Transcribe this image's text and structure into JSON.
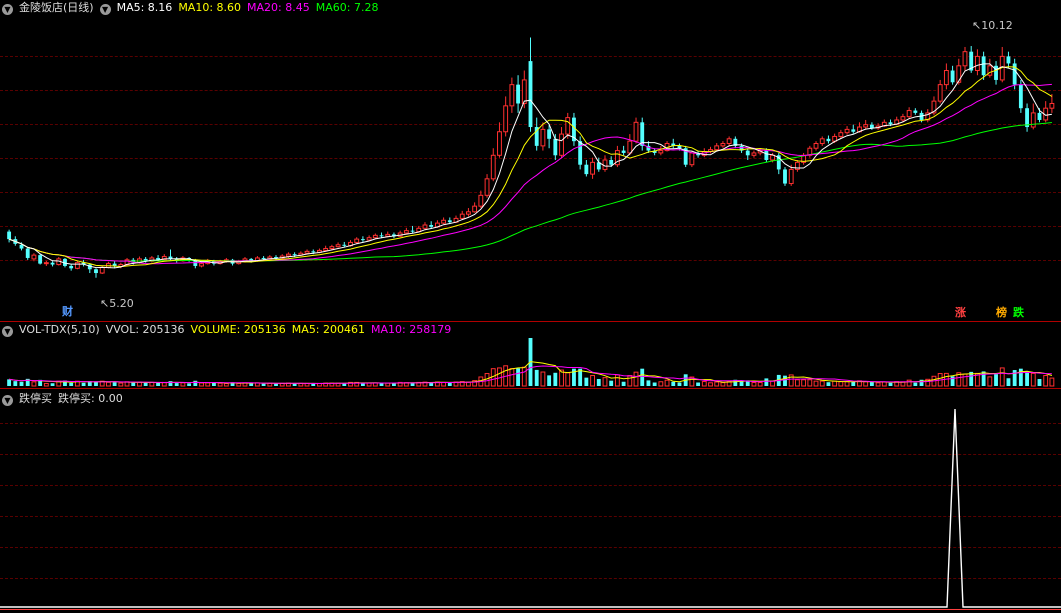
{
  "main_panel": {
    "title": "金陵饭店(日线)",
    "ma_legend": [
      {
        "label": "MA5: 8.16",
        "color": "#ffffff"
      },
      {
        "label": "MA10: 8.60",
        "color": "#ffff00"
      },
      {
        "label": "MA20: 8.45",
        "color": "#ff00ff"
      },
      {
        "label": "MA60: 7.28",
        "color": "#00ff00"
      }
    ],
    "high_label": "10.12",
    "low_label": "5.20",
    "marker_cai": "财",
    "marker_zhang": "涨",
    "marker_bang": "榜",
    "marker_die": "跌"
  },
  "volume_panel": {
    "title": "VOL-TDX(5,10)",
    "vvol": "VVOL: 205136",
    "volume": "VOLUME: 205136",
    "ma5": "MA5: 200461",
    "ma10": "MA10: 258179"
  },
  "indicator_panel": {
    "title": "跌停买",
    "value": "跌停买: 0.00"
  },
  "colors": {
    "up": "#ff3030",
    "down": "#54ffff",
    "ma5": "#ffffff",
    "ma10": "#ffff00",
    "ma20": "#ff00ff",
    "ma60": "#00ff00",
    "grid": "#5a0000",
    "background": "#000000"
  },
  "chart_data": {
    "type": "candlestick",
    "price_range": [
      4.6,
      10.8
    ],
    "high": 10.12,
    "low": 5.2,
    "candles": [
      [
        6.18,
        6.02,
        6.22,
        5.95
      ],
      [
        6.02,
        5.92,
        6.08,
        5.88
      ],
      [
        5.9,
        5.82,
        5.95,
        5.78
      ],
      [
        5.82,
        5.62,
        5.85,
        5.58
      ],
      [
        5.6,
        5.68,
        5.72,
        5.55
      ],
      [
        5.68,
        5.5,
        5.7,
        5.48
      ],
      [
        5.5,
        5.52,
        5.56,
        5.45
      ],
      [
        5.52,
        5.48,
        5.55,
        5.44
      ],
      [
        5.48,
        5.6,
        5.64,
        5.46
      ],
      [
        5.6,
        5.45,
        5.62,
        5.42
      ],
      [
        5.45,
        5.4,
        5.48,
        5.35
      ],
      [
        5.4,
        5.52,
        5.56,
        5.38
      ],
      [
        5.52,
        5.48,
        5.58,
        5.44
      ],
      [
        5.48,
        5.38,
        5.5,
        5.3
      ],
      [
        5.38,
        5.3,
        5.4,
        5.2
      ],
      [
        5.3,
        5.42,
        5.46,
        5.28
      ],
      [
        5.42,
        5.5,
        5.54,
        5.4
      ],
      [
        5.5,
        5.44,
        5.56,
        5.4
      ],
      [
        5.44,
        5.48,
        5.52,
        5.4
      ],
      [
        5.48,
        5.58,
        5.62,
        5.46
      ],
      [
        5.58,
        5.52,
        5.62,
        5.48
      ],
      [
        5.52,
        5.6,
        5.65,
        5.5
      ],
      [
        5.6,
        5.55,
        5.64,
        5.52
      ],
      [
        5.55,
        5.62,
        5.66,
        5.52
      ],
      [
        5.62,
        5.58,
        5.68,
        5.55
      ],
      [
        5.58,
        5.65,
        5.7,
        5.56
      ],
      [
        5.65,
        5.6,
        5.8,
        5.56
      ],
      [
        5.6,
        5.56,
        5.64,
        5.52
      ],
      [
        5.56,
        5.62,
        5.66,
        5.54
      ],
      [
        5.62,
        5.58,
        5.64,
        5.54
      ],
      [
        5.58,
        5.45,
        5.6,
        5.4
      ],
      [
        5.45,
        5.5,
        5.54,
        5.42
      ],
      [
        5.5,
        5.56,
        5.6,
        5.48
      ],
      [
        5.56,
        5.5,
        5.58,
        5.46
      ],
      [
        5.5,
        5.55,
        5.58,
        5.48
      ],
      [
        5.55,
        5.58,
        5.62,
        5.52
      ],
      [
        5.58,
        5.5,
        5.6,
        5.46
      ],
      [
        5.5,
        5.54,
        5.58,
        5.48
      ],
      [
        5.54,
        5.6,
        5.64,
        5.52
      ],
      [
        5.6,
        5.56,
        5.62,
        5.52
      ],
      [
        5.56,
        5.62,
        5.66,
        5.54
      ],
      [
        5.62,
        5.6,
        5.66,
        5.56
      ],
      [
        5.6,
        5.64,
        5.68,
        5.58
      ],
      [
        5.64,
        5.62,
        5.68,
        5.58
      ],
      [
        5.62,
        5.66,
        5.7,
        5.6
      ],
      [
        5.66,
        5.7,
        5.74,
        5.62
      ],
      [
        5.7,
        5.68,
        5.74,
        5.64
      ],
      [
        5.68,
        5.72,
        5.76,
        5.66
      ],
      [
        5.72,
        5.76,
        5.8,
        5.7
      ],
      [
        5.76,
        5.74,
        5.8,
        5.7
      ],
      [
        5.74,
        5.78,
        5.82,
        5.72
      ],
      [
        5.78,
        5.82,
        5.88,
        5.76
      ],
      [
        5.82,
        5.86,
        5.9,
        5.78
      ],
      [
        5.86,
        5.9,
        5.95,
        5.84
      ],
      [
        5.9,
        5.88,
        5.96,
        5.84
      ],
      [
        5.88,
        5.95,
        6.0,
        5.86
      ],
      [
        5.95,
        6.02,
        6.06,
        5.92
      ],
      [
        6.02,
        6.0,
        6.08,
        5.96
      ],
      [
        6.0,
        6.05,
        6.1,
        5.98
      ],
      [
        6.05,
        6.1,
        6.14,
        6.02
      ],
      [
        6.1,
        6.08,
        6.16,
        6.04
      ],
      [
        6.08,
        6.12,
        6.18,
        6.06
      ],
      [
        6.12,
        6.08,
        6.16,
        6.04
      ],
      [
        6.08,
        6.15,
        6.2,
        6.06
      ],
      [
        6.15,
        6.2,
        6.26,
        6.12
      ],
      [
        6.2,
        6.18,
        6.3,
        6.14
      ],
      [
        6.18,
        6.25,
        6.3,
        6.16
      ],
      [
        6.25,
        6.32,
        6.38,
        6.22
      ],
      [
        6.32,
        6.28,
        6.4,
        6.24
      ],
      [
        6.28,
        6.36,
        6.42,
        6.26
      ],
      [
        6.36,
        6.42,
        6.48,
        6.34
      ],
      [
        6.42,
        6.38,
        6.48,
        6.34
      ],
      [
        6.38,
        6.46,
        6.52,
        6.36
      ],
      [
        6.46,
        6.55,
        6.62,
        6.44
      ],
      [
        6.55,
        6.6,
        6.68,
        6.5
      ],
      [
        6.6,
        6.72,
        6.8,
        6.58
      ],
      [
        6.72,
        6.95,
        7.05,
        6.68
      ],
      [
        6.95,
        7.3,
        7.4,
        6.9
      ],
      [
        7.3,
        7.8,
        7.95,
        7.25
      ],
      [
        7.8,
        8.3,
        8.5,
        7.75
      ],
      [
        8.3,
        8.85,
        9.05,
        8.2
      ],
      [
        8.85,
        9.3,
        9.45,
        8.7
      ],
      [
        9.3,
        8.9,
        9.5,
        8.7
      ],
      [
        8.9,
        9.4,
        9.6,
        8.8
      ],
      [
        9.8,
        8.4,
        10.3,
        8.3
      ],
      [
        8.4,
        8.0,
        8.6,
        7.9
      ],
      [
        8.0,
        8.35,
        8.5,
        7.9
      ],
      [
        8.35,
        8.15,
        8.45,
        7.95
      ],
      [
        8.15,
        7.8,
        8.25,
        7.7
      ],
      [
        7.8,
        8.25,
        8.4,
        7.75
      ],
      [
        8.25,
        8.6,
        8.7,
        8.15
      ],
      [
        8.6,
        8.1,
        8.7,
        8.0
      ],
      [
        8.1,
        7.6,
        8.2,
        7.5
      ],
      [
        7.6,
        7.4,
        7.7,
        7.35
      ],
      [
        7.4,
        7.65,
        7.75,
        7.3
      ],
      [
        7.65,
        7.5,
        7.75,
        7.45
      ],
      [
        7.5,
        7.7,
        7.8,
        7.45
      ],
      [
        7.7,
        7.6,
        7.78,
        7.55
      ],
      [
        7.6,
        7.9,
        8.0,
        7.55
      ],
      [
        7.9,
        7.85,
        8.0,
        7.8
      ],
      [
        7.85,
        8.1,
        8.25,
        7.8
      ],
      [
        8.1,
        8.5,
        8.6,
        8.05
      ],
      [
        8.5,
        8.0,
        8.6,
        7.9
      ],
      [
        8.0,
        7.9,
        8.1,
        7.85
      ],
      [
        7.9,
        7.85,
        7.95,
        7.8
      ],
      [
        7.85,
        7.9,
        8.0,
        7.8
      ],
      [
        7.9,
        8.05,
        8.1,
        7.88
      ],
      [
        8.05,
        8.0,
        8.15,
        7.95
      ],
      [
        8.0,
        7.95,
        8.05,
        7.9
      ],
      [
        7.95,
        7.6,
        8.0,
        7.55
      ],
      [
        7.6,
        7.85,
        7.9,
        7.55
      ],
      [
        7.85,
        7.8,
        7.9,
        7.75
      ],
      [
        7.8,
        7.88,
        7.95,
        7.76
      ],
      [
        7.88,
        7.92,
        7.98,
        7.84
      ],
      [
        7.92,
        8.0,
        8.06,
        7.9
      ],
      [
        8.0,
        8.05,
        8.1,
        7.96
      ],
      [
        8.05,
        8.15,
        8.2,
        8.0
      ],
      [
        8.15,
        8.0,
        8.2,
        7.95
      ],
      [
        8.0,
        7.9,
        8.05,
        7.85
      ],
      [
        7.9,
        7.8,
        7.95,
        7.7
      ],
      [
        7.8,
        7.85,
        7.9,
        7.75
      ],
      [
        7.85,
        7.9,
        7.95,
        7.8
      ],
      [
        7.9,
        7.7,
        7.95,
        7.65
      ],
      [
        7.7,
        7.8,
        7.85,
        7.65
      ],
      [
        7.8,
        7.5,
        7.85,
        7.4
      ],
      [
        7.5,
        7.2,
        7.55,
        7.15
      ],
      [
        7.2,
        7.5,
        7.6,
        7.15
      ],
      [
        7.5,
        7.65,
        7.7,
        7.45
      ],
      [
        7.65,
        7.8,
        7.85,
        7.6
      ],
      [
        7.8,
        7.95,
        8.0,
        7.75
      ],
      [
        7.95,
        8.05,
        8.1,
        7.9
      ],
      [
        8.05,
        8.15,
        8.2,
        8.0
      ],
      [
        8.15,
        8.1,
        8.22,
        8.05
      ],
      [
        8.1,
        8.2,
        8.26,
        8.06
      ],
      [
        8.2,
        8.28,
        8.34,
        8.16
      ],
      [
        8.28,
        8.35,
        8.42,
        8.24
      ],
      [
        8.35,
        8.3,
        8.45,
        8.26
      ],
      [
        8.3,
        8.4,
        8.5,
        8.28
      ],
      [
        8.4,
        8.45,
        8.55,
        8.35
      ],
      [
        8.45,
        8.38,
        8.5,
        8.34
      ],
      [
        8.38,
        8.42,
        8.48,
        8.34
      ],
      [
        8.42,
        8.5,
        8.56,
        8.4
      ],
      [
        8.5,
        8.46,
        8.56,
        8.42
      ],
      [
        8.46,
        8.55,
        8.62,
        8.44
      ],
      [
        8.55,
        8.62,
        8.68,
        8.5
      ],
      [
        8.62,
        8.75,
        8.82,
        8.58
      ],
      [
        8.75,
        8.7,
        8.8,
        8.66
      ],
      [
        8.7,
        8.55,
        8.75,
        8.5
      ],
      [
        8.55,
        8.7,
        8.78,
        8.5
      ],
      [
        8.7,
        8.95,
        9.05,
        8.65
      ],
      [
        8.95,
        9.3,
        9.4,
        8.9
      ],
      [
        9.3,
        9.6,
        9.75,
        9.2
      ],
      [
        9.6,
        9.35,
        9.7,
        9.3
      ],
      [
        9.35,
        9.7,
        9.85,
        9.3
      ],
      [
        9.7,
        10.0,
        10.1,
        9.6
      ],
      [
        10.0,
        9.6,
        10.12,
        9.55
      ],
      [
        9.6,
        9.9,
        10.05,
        9.5
      ],
      [
        9.9,
        9.5,
        10.0,
        9.4
      ],
      [
        9.5,
        9.7,
        9.85,
        9.45
      ],
      [
        9.7,
        9.4,
        9.8,
        9.3
      ],
      [
        9.4,
        9.9,
        10.1,
        9.35
      ],
      [
        9.9,
        9.75,
        10.0,
        9.65
      ],
      [
        9.75,
        9.3,
        9.85,
        9.2
      ],
      [
        9.3,
        8.8,
        9.4,
        8.7
      ],
      [
        8.8,
        8.4,
        8.9,
        8.3
      ],
      [
        8.4,
        8.7,
        8.9,
        8.35
      ],
      [
        8.7,
        8.55,
        8.8,
        8.5
      ],
      [
        8.55,
        8.8,
        8.95,
        8.5
      ],
      [
        8.8,
        8.9,
        9.1,
        8.7
      ]
    ]
  }
}
